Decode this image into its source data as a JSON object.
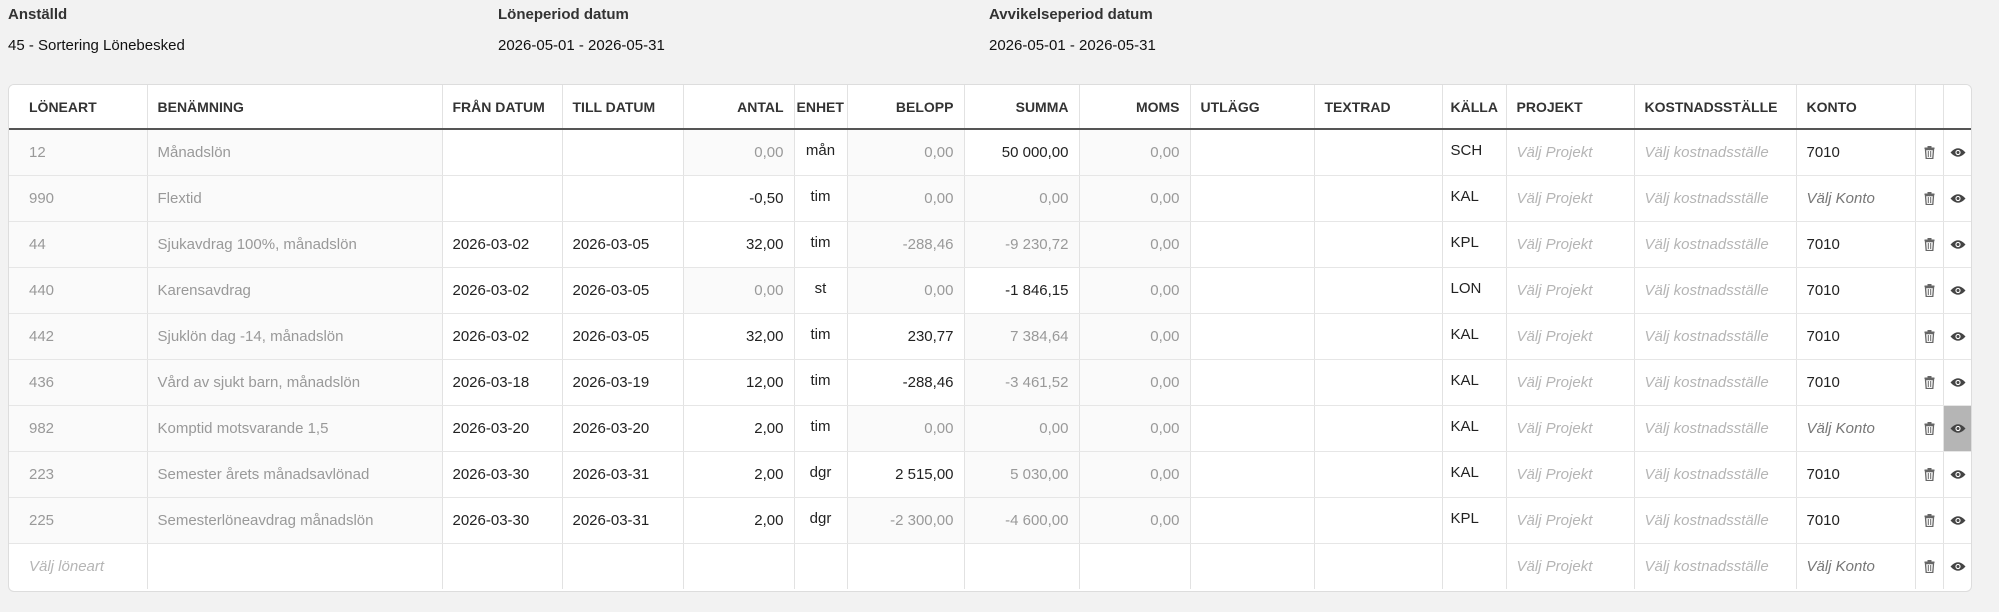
{
  "header": {
    "employee_label": "Anställd",
    "employee_value": "45 - Sortering Lönebesked",
    "pay_period_label": "Löneperiod datum",
    "pay_period_value": "2026-05-01 - 2026-05-31",
    "deviation_period_label": "Avvikelseperiod datum",
    "deviation_period_value": "2026-05-01 - 2026-05-31"
  },
  "columns": {
    "loneart": "LÖNEART",
    "benamning": "BENÄMNING",
    "fran": "FRÅN DATUM",
    "till": "TILL DATUM",
    "antal": "ANTAL",
    "enhet": "ENHET",
    "belopp": "BELOPP",
    "summa": "SUMMA",
    "moms": "MOMS",
    "utlagg": "UTLÄGG",
    "textrad": "TEXTRAD",
    "kalla": "KÄLLA",
    "projekt": "PROJEKT",
    "kostnadsstalle": "KOSTNADSSTÄLLE",
    "konto": "KONTO"
  },
  "placeholders": {
    "projekt": "Välj Projekt",
    "kostnadsstalle": "Välj kostnadsställe",
    "konto": "Välj Konto",
    "loneart": "Välj löneart"
  },
  "rows": [
    {
      "loneart": "12",
      "benamning": "Månadslön",
      "fran": "",
      "till": "",
      "antal": "0,00",
      "enhet": "mån",
      "belopp": "0,00",
      "summa": "50 000,00",
      "moms": "0,00",
      "utlagg": "",
      "textrad": "",
      "kalla": "SCH",
      "konto": "7010"
    },
    {
      "loneart": "990",
      "benamning": "Flextid",
      "fran": "",
      "till": "",
      "antal": "-0,50",
      "enhet": "tim",
      "belopp": "0,00",
      "summa": "0,00",
      "moms": "0,00",
      "utlagg": "",
      "textrad": "",
      "kalla": "KAL",
      "konto": ""
    },
    {
      "loneart": "44",
      "benamning": "Sjukavdrag 100%, månadslön",
      "fran": "2026-03-02",
      "till": "2026-03-05",
      "antal": "32,00",
      "enhet": "tim",
      "belopp": "-288,46",
      "summa": "-9 230,72",
      "moms": "0,00",
      "utlagg": "",
      "textrad": "",
      "kalla": "KPL",
      "konto": "7010"
    },
    {
      "loneart": "440",
      "benamning": "Karensavdrag",
      "fran": "2026-03-02",
      "till": "2026-03-05",
      "antal": "0,00",
      "enhet": "st",
      "belopp": "0,00",
      "summa": "-1 846,15",
      "moms": "0,00",
      "utlagg": "",
      "textrad": "",
      "kalla": "LON",
      "konto": "7010"
    },
    {
      "loneart": "442",
      "benamning": "Sjuklön dag -14, månadslön",
      "fran": "2026-03-02",
      "till": "2026-03-05",
      "antal": "32,00",
      "enhet": "tim",
      "belopp": "230,77",
      "summa": "7 384,64",
      "moms": "0,00",
      "utlagg": "",
      "textrad": "",
      "kalla": "KAL",
      "konto": "7010"
    },
    {
      "loneart": "436",
      "benamning": "Vård av sjukt barn, månadslön",
      "fran": "2026-03-18",
      "till": "2026-03-19",
      "antal": "12,00",
      "enhet": "tim",
      "belopp": "-288,46",
      "summa": "-3 461,52",
      "moms": "0,00",
      "utlagg": "",
      "textrad": "",
      "kalla": "KAL",
      "konto": "7010"
    },
    {
      "loneart": "982",
      "benamning": "Komptid motsvarande 1,5",
      "fran": "2026-03-20",
      "till": "2026-03-20",
      "antal": "2,00",
      "enhet": "tim",
      "belopp": "0,00",
      "summa": "0,00",
      "moms": "0,00",
      "utlagg": "",
      "textrad": "",
      "kalla": "KAL",
      "konto": ""
    },
    {
      "loneart": "223",
      "benamning": "Semester årets månadsavlönad",
      "fran": "2026-03-30",
      "till": "2026-03-31",
      "antal": "2,00",
      "enhet": "dgr",
      "belopp": "2 515,00",
      "summa": "5 030,00",
      "moms": "0,00",
      "utlagg": "",
      "textrad": "",
      "kalla": "KAL",
      "konto": "7010"
    },
    {
      "loneart": "225",
      "benamning": "Semesterlöneavdrag månadslön",
      "fran": "2026-03-30",
      "till": "2026-03-31",
      "antal": "2,00",
      "enhet": "dgr",
      "belopp": "-2 300,00",
      "summa": "-4 600,00",
      "moms": "0,00",
      "utlagg": "",
      "textrad": "",
      "kalla": "KPL",
      "konto": "7010"
    }
  ],
  "icons": {
    "delete": "trash-icon",
    "view": "eye-icon"
  },
  "colors": {
    "active_view_cell": "#b5b5b5",
    "placeholder": "#b5b5b5"
  }
}
